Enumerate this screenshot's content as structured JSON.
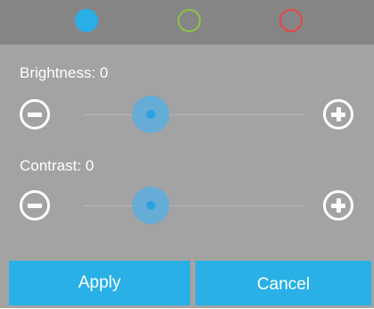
{
  "palette": {
    "dots": [
      {
        "name": "blue",
        "color": "#29aee6",
        "filled": true
      },
      {
        "name": "green",
        "color": "#8bc34a",
        "filled": false
      },
      {
        "name": "red",
        "color": "#e64646",
        "filled": false
      }
    ],
    "accent": "#29b0e6"
  },
  "brightness": {
    "label": "Brightness: 0",
    "value": 0,
    "decrease_icon": "minus-circle-icon",
    "increase_icon": "plus-circle-icon"
  },
  "contrast": {
    "label": "Contrast: 0",
    "value": 0,
    "decrease_icon": "minus-circle-icon",
    "increase_icon": "plus-circle-icon"
  },
  "actions": {
    "apply_label": "Apply",
    "cancel_label": "Cancel"
  }
}
